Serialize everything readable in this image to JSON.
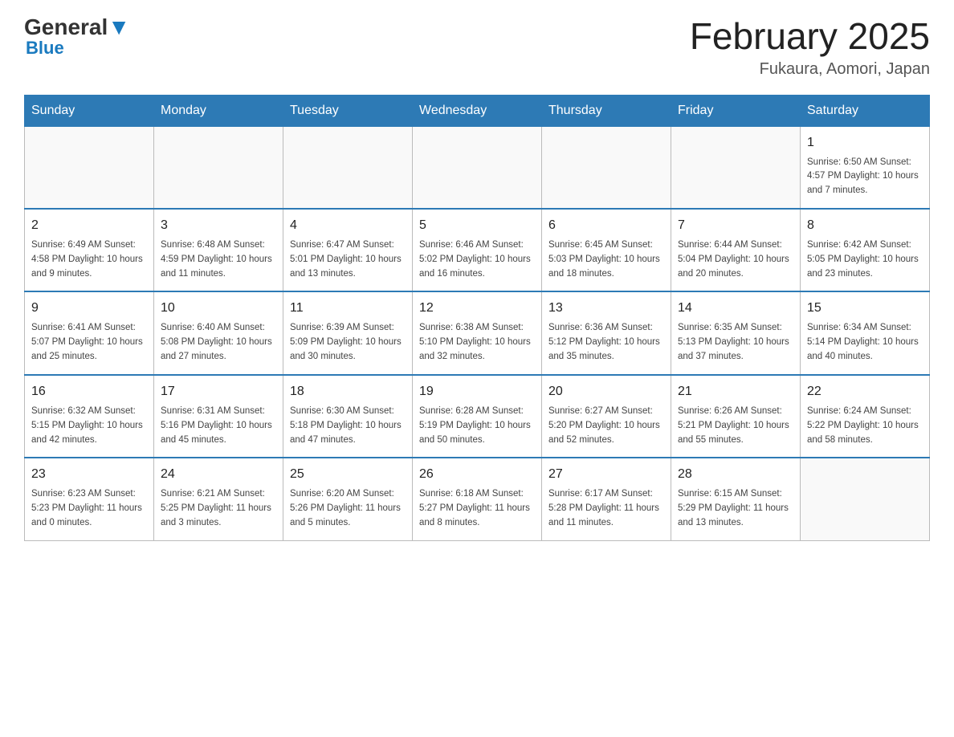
{
  "header": {
    "logo_general": "General",
    "logo_blue": "Blue",
    "title": "February 2025",
    "location": "Fukaura, Aomori, Japan"
  },
  "days_of_week": [
    "Sunday",
    "Monday",
    "Tuesday",
    "Wednesday",
    "Thursday",
    "Friday",
    "Saturday"
  ],
  "weeks": [
    [
      {
        "day": "",
        "info": ""
      },
      {
        "day": "",
        "info": ""
      },
      {
        "day": "",
        "info": ""
      },
      {
        "day": "",
        "info": ""
      },
      {
        "day": "",
        "info": ""
      },
      {
        "day": "",
        "info": ""
      },
      {
        "day": "1",
        "info": "Sunrise: 6:50 AM\nSunset: 4:57 PM\nDaylight: 10 hours and 7 minutes."
      }
    ],
    [
      {
        "day": "2",
        "info": "Sunrise: 6:49 AM\nSunset: 4:58 PM\nDaylight: 10 hours and 9 minutes."
      },
      {
        "day": "3",
        "info": "Sunrise: 6:48 AM\nSunset: 4:59 PM\nDaylight: 10 hours and 11 minutes."
      },
      {
        "day": "4",
        "info": "Sunrise: 6:47 AM\nSunset: 5:01 PM\nDaylight: 10 hours and 13 minutes."
      },
      {
        "day": "5",
        "info": "Sunrise: 6:46 AM\nSunset: 5:02 PM\nDaylight: 10 hours and 16 minutes."
      },
      {
        "day": "6",
        "info": "Sunrise: 6:45 AM\nSunset: 5:03 PM\nDaylight: 10 hours and 18 minutes."
      },
      {
        "day": "7",
        "info": "Sunrise: 6:44 AM\nSunset: 5:04 PM\nDaylight: 10 hours and 20 minutes."
      },
      {
        "day": "8",
        "info": "Sunrise: 6:42 AM\nSunset: 5:05 PM\nDaylight: 10 hours and 23 minutes."
      }
    ],
    [
      {
        "day": "9",
        "info": "Sunrise: 6:41 AM\nSunset: 5:07 PM\nDaylight: 10 hours and 25 minutes."
      },
      {
        "day": "10",
        "info": "Sunrise: 6:40 AM\nSunset: 5:08 PM\nDaylight: 10 hours and 27 minutes."
      },
      {
        "day": "11",
        "info": "Sunrise: 6:39 AM\nSunset: 5:09 PM\nDaylight: 10 hours and 30 minutes."
      },
      {
        "day": "12",
        "info": "Sunrise: 6:38 AM\nSunset: 5:10 PM\nDaylight: 10 hours and 32 minutes."
      },
      {
        "day": "13",
        "info": "Sunrise: 6:36 AM\nSunset: 5:12 PM\nDaylight: 10 hours and 35 minutes."
      },
      {
        "day": "14",
        "info": "Sunrise: 6:35 AM\nSunset: 5:13 PM\nDaylight: 10 hours and 37 minutes."
      },
      {
        "day": "15",
        "info": "Sunrise: 6:34 AM\nSunset: 5:14 PM\nDaylight: 10 hours and 40 minutes."
      }
    ],
    [
      {
        "day": "16",
        "info": "Sunrise: 6:32 AM\nSunset: 5:15 PM\nDaylight: 10 hours and 42 minutes."
      },
      {
        "day": "17",
        "info": "Sunrise: 6:31 AM\nSunset: 5:16 PM\nDaylight: 10 hours and 45 minutes."
      },
      {
        "day": "18",
        "info": "Sunrise: 6:30 AM\nSunset: 5:18 PM\nDaylight: 10 hours and 47 minutes."
      },
      {
        "day": "19",
        "info": "Sunrise: 6:28 AM\nSunset: 5:19 PM\nDaylight: 10 hours and 50 minutes."
      },
      {
        "day": "20",
        "info": "Sunrise: 6:27 AM\nSunset: 5:20 PM\nDaylight: 10 hours and 52 minutes."
      },
      {
        "day": "21",
        "info": "Sunrise: 6:26 AM\nSunset: 5:21 PM\nDaylight: 10 hours and 55 minutes."
      },
      {
        "day": "22",
        "info": "Sunrise: 6:24 AM\nSunset: 5:22 PM\nDaylight: 10 hours and 58 minutes."
      }
    ],
    [
      {
        "day": "23",
        "info": "Sunrise: 6:23 AM\nSunset: 5:23 PM\nDaylight: 11 hours and 0 minutes."
      },
      {
        "day": "24",
        "info": "Sunrise: 6:21 AM\nSunset: 5:25 PM\nDaylight: 11 hours and 3 minutes."
      },
      {
        "day": "25",
        "info": "Sunrise: 6:20 AM\nSunset: 5:26 PM\nDaylight: 11 hours and 5 minutes."
      },
      {
        "day": "26",
        "info": "Sunrise: 6:18 AM\nSunset: 5:27 PM\nDaylight: 11 hours and 8 minutes."
      },
      {
        "day": "27",
        "info": "Sunrise: 6:17 AM\nSunset: 5:28 PM\nDaylight: 11 hours and 11 minutes."
      },
      {
        "day": "28",
        "info": "Sunrise: 6:15 AM\nSunset: 5:29 PM\nDaylight: 11 hours and 13 minutes."
      },
      {
        "day": "",
        "info": ""
      }
    ]
  ]
}
